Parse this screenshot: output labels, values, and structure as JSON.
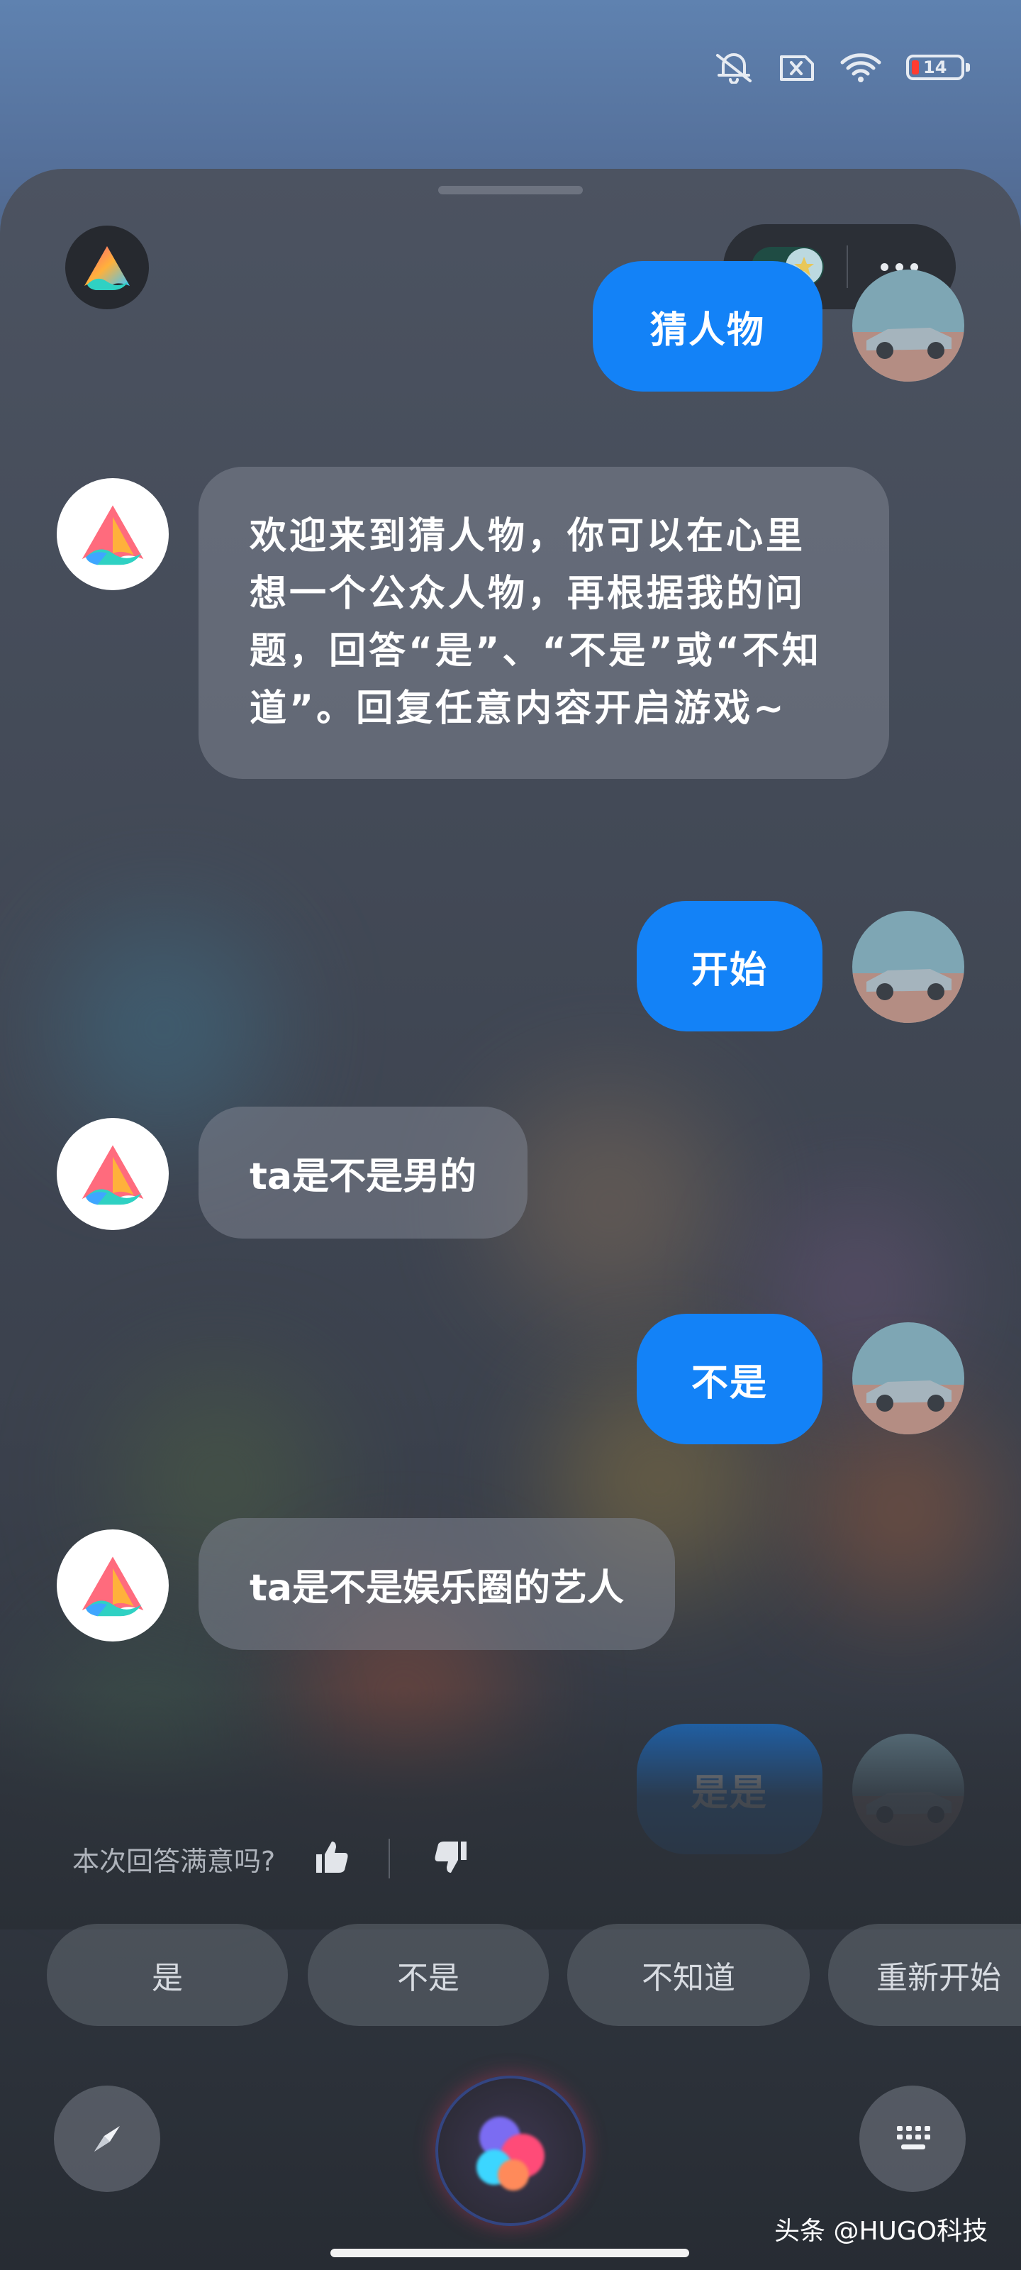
{
  "status_bar": {
    "icons": [
      "mute-vibrate-icon",
      "no-sim-icon",
      "wifi-icon",
      "battery-icon"
    ],
    "battery_level": "14",
    "battery_color": "#ff3b30"
  },
  "header": {
    "app_icon": "ai-assistant-logo",
    "more_icon": "more-dots-icon"
  },
  "messages": [
    {
      "role": "user",
      "text": "猜人物"
    },
    {
      "role": "assistant",
      "text": "欢迎来到猜人物，你可以在心里想一个公众人物，再根据我的问题，回答“是”、“不是”或“不知道”。回复任意内容开启游戏~"
    },
    {
      "role": "user",
      "text": "开始"
    },
    {
      "role": "assistant",
      "text": "ta是不是男的"
    },
    {
      "role": "user",
      "text": "不是"
    },
    {
      "role": "assistant",
      "text": "ta是不是娱乐圈的艺人"
    },
    {
      "role": "user",
      "text": "是是"
    }
  ],
  "feedback": {
    "question": "本次回答满意吗?",
    "like_icon": "thumbs-up-icon",
    "dislike_icon": "thumbs-down-icon"
  },
  "quick_replies": [
    "是",
    "不是",
    "不知道",
    "重新开始"
  ],
  "bottom_bar": {
    "left_icon": "compass-icon",
    "center_icon": "voice-orb-icon",
    "right_icon": "keyboard-icon"
  },
  "watermark": "头条 @HUGO科技",
  "colors": {
    "accent": "#1382f7",
    "user_bubble": "#1382f7",
    "assistant_bubble": "#6f7582"
  }
}
